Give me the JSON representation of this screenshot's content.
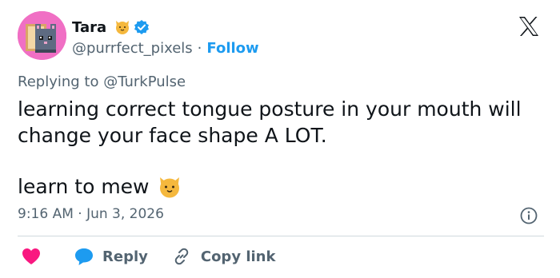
{
  "user": {
    "display_name": "Tara",
    "handle": "@purrfect_pixels",
    "separator": "·",
    "follow_label": "Follow"
  },
  "replying": {
    "prefix": "Replying to",
    "mention": "@TurkPulse"
  },
  "tweet": {
    "text": "learning correct tongue posture in your mouth will\nchange your face shape A LOT.",
    "line3": "learn to mew"
  },
  "timestamp": "9:16 AM · Jun 3, 2026",
  "actions": {
    "reply_label": "Reply",
    "copy_link_label": "Copy link"
  },
  "icons": {
    "avatar": "pixel-cat-toast-avatar",
    "name_emoji": "cat-face-emoji",
    "verified": "verified-badge-icon",
    "logo": "x-logo-icon",
    "text_emoji": "cat-face-emoji",
    "info": "info-icon",
    "like": "heart-icon",
    "reply": "reply-bubble-icon",
    "copy": "link-icon"
  },
  "colors": {
    "accent": "#1d9bf0",
    "heart": "#f91880",
    "text": "#0f1419",
    "muted": "#536471",
    "avatar_bg": "#f06fc4"
  }
}
